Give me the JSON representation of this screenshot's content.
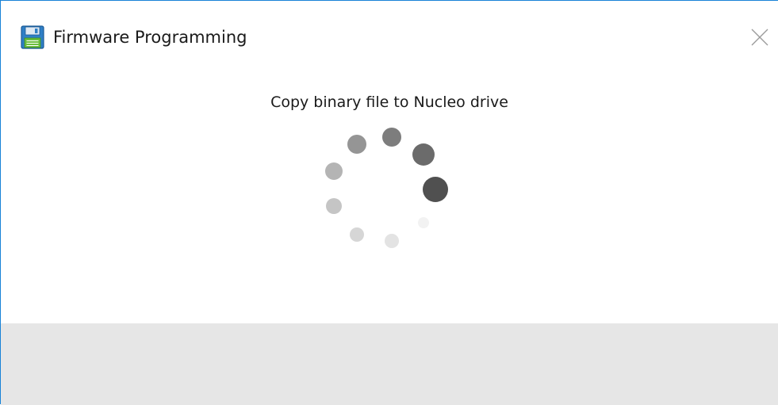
{
  "window": {
    "title": "Firmware Programming",
    "app_icon": "floppy-disk-icon",
    "close_icon": "close-icon",
    "border_color": "#1883d7"
  },
  "content": {
    "message": "Copy binary file to Nucleo drive",
    "spinner_icon": "loading-spinner-icon"
  },
  "colors": {
    "footer_background": "#e6e6e6",
    "spinner_dark": "#505050",
    "spinner_light": "#f0f0f0"
  }
}
